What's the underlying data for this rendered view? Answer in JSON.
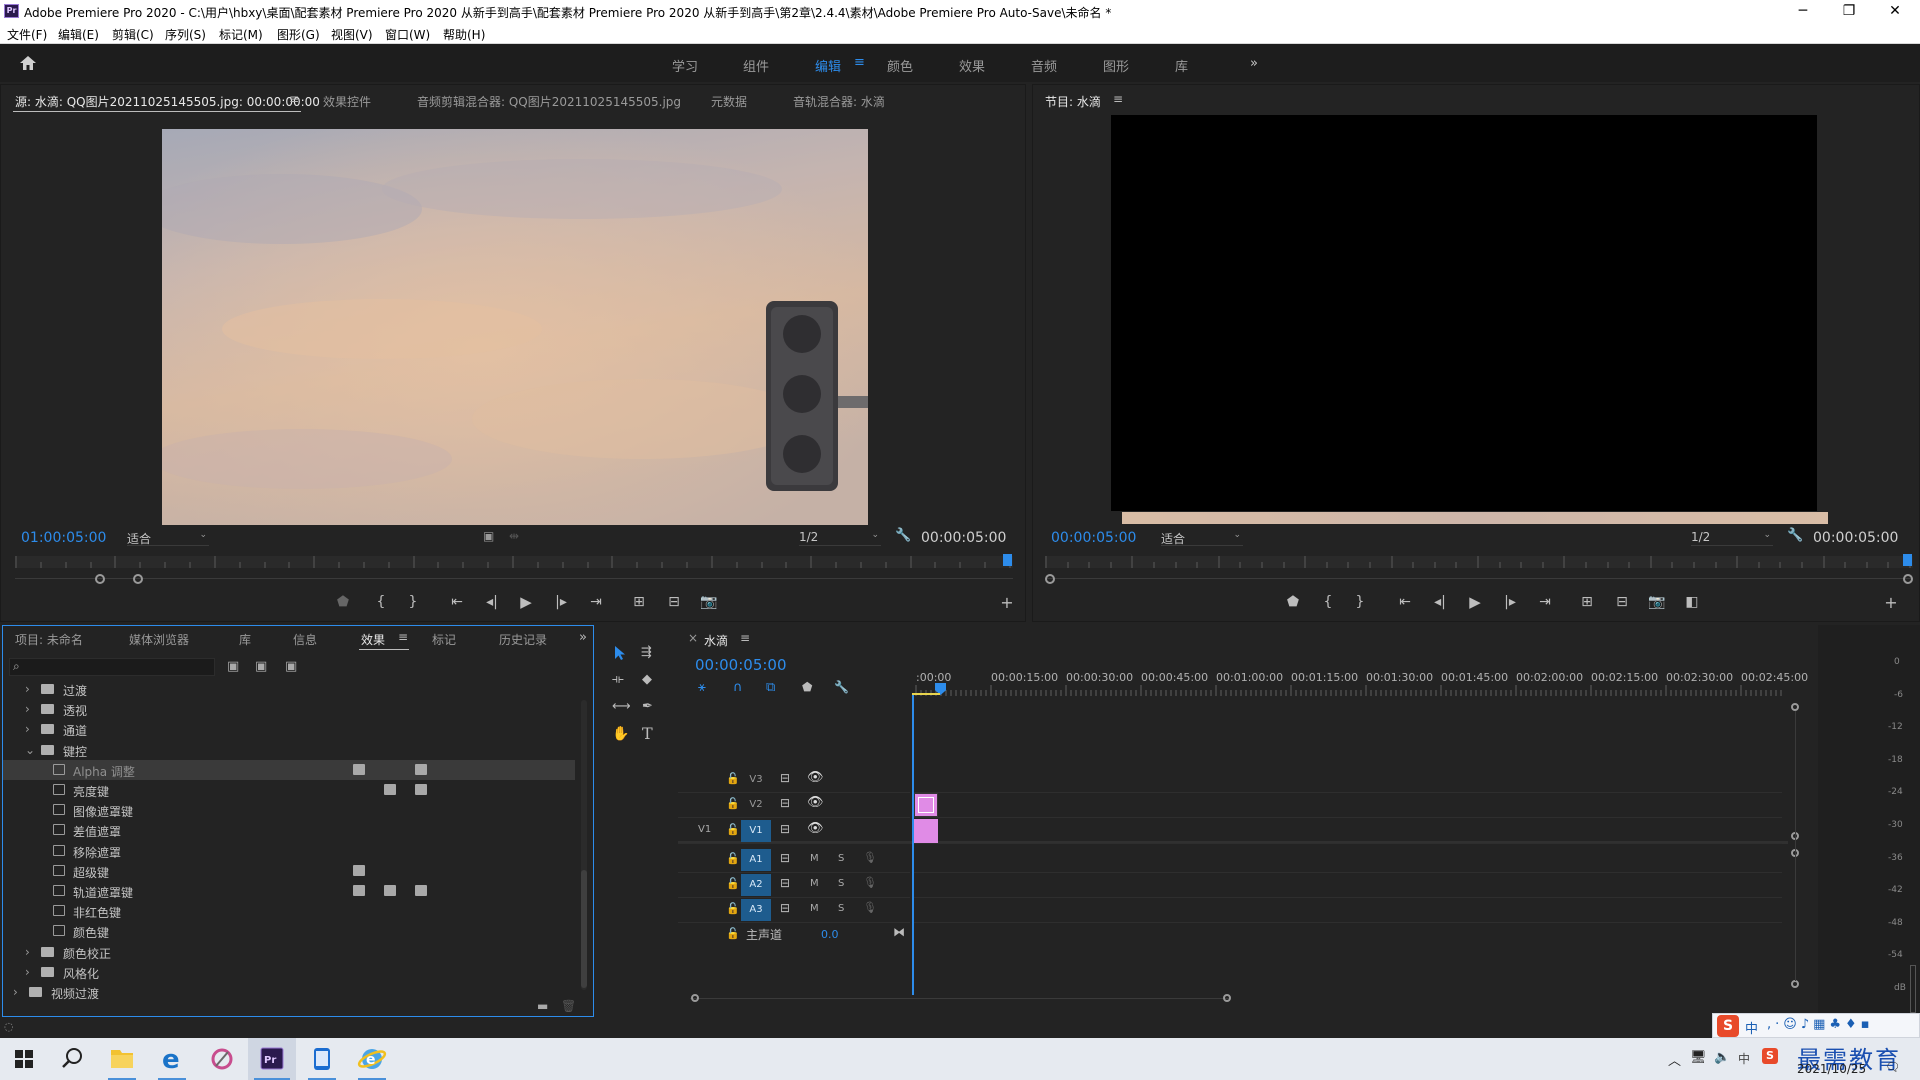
{
  "titlebar": {
    "title": "Adobe Premiere Pro 2020 - C:\\用户\\hbxy\\桌面\\配套素材 Premiere Pro 2020 从新手到高手\\配套素材 Premiere Pro 2020 从新手到高手\\第2章\\2.4.4\\素材\\Adobe Premiere Pro Auto-Save\\未命名 *",
    "app_icon": "Pr"
  },
  "menu": [
    "文件(F)",
    "编辑(E)",
    "剪辑(C)",
    "序列(S)",
    "标记(M)",
    "图形(G)",
    "视图(V)",
    "窗口(W)",
    "帮助(H)"
  ],
  "workspaces": {
    "items": [
      "学习",
      "组件",
      "编辑",
      "颜色",
      "效果",
      "音频",
      "图形",
      "库"
    ],
    "active": "编辑",
    "more": "»"
  },
  "source_monitor": {
    "tabs": [
      "源: 水滴: QQ图片20211025145505.jpg: 00:00:00:00",
      "效果控件",
      "音频剪辑混合器: QQ图片20211025145505.jpg",
      "元数据",
      "音轨混合器: 水滴"
    ],
    "timecode_in": "01:00:05:00",
    "fit": "适合",
    "resolution": "1/2",
    "timecode_out": "00:00:05:00",
    "playhead_fraction": 1.0
  },
  "program_monitor": {
    "title": "节目: 水滴",
    "timecode_in": "00:00:05:00",
    "fit": "适合",
    "resolution": "1/2",
    "timecode_out": "00:00:05:00",
    "playhead_fraction": 1.0
  },
  "project_panel": {
    "tabs": [
      "项目: 未命名",
      "媒体浏览器",
      "库",
      "信息",
      "效果",
      "标记",
      "历史记录"
    ],
    "active_tab": "效果",
    "search_placeholder": "",
    "tree": [
      {
        "label": "过渡",
        "type": "folder",
        "expanded": false,
        "indent": 1
      },
      {
        "label": "透视",
        "type": "folder",
        "expanded": false,
        "indent": 1
      },
      {
        "label": "通道",
        "type": "folder",
        "expanded": false,
        "indent": 1
      },
      {
        "label": "键控",
        "type": "folder",
        "expanded": true,
        "indent": 1
      },
      {
        "label": "Alpha 调整",
        "type": "effect",
        "indent": 2,
        "selected": true
      },
      {
        "label": "亮度键",
        "type": "effect",
        "indent": 2
      },
      {
        "label": "图像遮罩键",
        "type": "effect",
        "indent": 2
      },
      {
        "label": "差值遮罩",
        "type": "effect",
        "indent": 2
      },
      {
        "label": "移除遮罩",
        "type": "effect",
        "indent": 2
      },
      {
        "label": "超级键",
        "type": "effect",
        "indent": 2
      },
      {
        "label": "轨道遮罩键",
        "type": "effect",
        "indent": 2
      },
      {
        "label": "非红色键",
        "type": "effect",
        "indent": 2
      },
      {
        "label": "颜色键",
        "type": "effect",
        "indent": 2
      },
      {
        "label": "颜色校正",
        "type": "folder",
        "expanded": false,
        "indent": 1
      },
      {
        "label": "风格化",
        "type": "folder",
        "expanded": false,
        "indent": 1
      },
      {
        "label": "视频过渡",
        "type": "folder",
        "expanded": false,
        "indent": 0
      }
    ]
  },
  "timeline": {
    "sequence_name": "水滴",
    "timecode": "00:00:05:00",
    "ruler_labels": [
      ":00:00",
      "00:00:15:00",
      "00:00:30:00",
      "00:00:45:00",
      "00:01:00:00",
      "00:01:15:00",
      "00:01:30:00",
      "00:01:45:00",
      "00:02:00:00",
      "00:02:15:00",
      "00:02:30:00",
      "00:02:45:00"
    ],
    "video_tracks": [
      "V3",
      "V2",
      "V1"
    ],
    "source_patch": "V1",
    "audio_tracks": [
      "A1",
      "A2",
      "A3"
    ],
    "mix_track": {
      "label": "主声道",
      "value": "0.0"
    },
    "clip_color": "#e08be6",
    "toggle_labels": {
      "mute": "M",
      "solo": "S"
    }
  },
  "audio_meter": {
    "labels": [
      "0",
      "-6",
      "-12",
      "-18",
      "-24",
      "-30",
      "-36",
      "-42",
      "-48",
      "-54",
      "dB"
    ]
  },
  "taskbar": {
    "clock_time": "",
    "clock_date": "2021/10/25",
    "ime": "中",
    "watermark": "最需教育"
  },
  "colors": {
    "accent": "#2d8ceb",
    "panel": "#232323",
    "clip": "#e08be6",
    "track_target": "#1e5c8e"
  }
}
